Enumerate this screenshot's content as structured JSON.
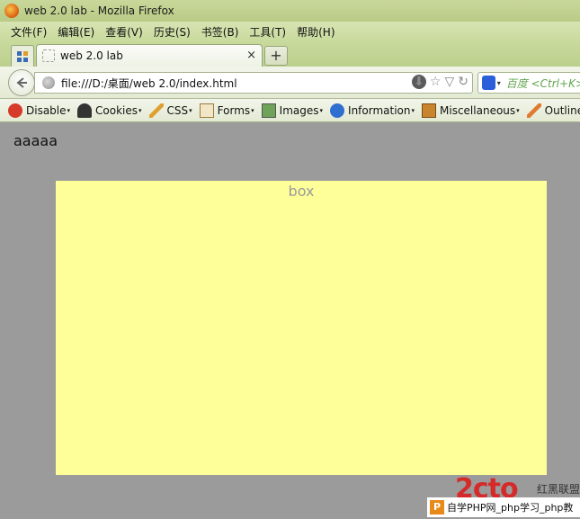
{
  "window": {
    "title": "web 2.0 lab - Mozilla Firefox"
  },
  "menubar": {
    "items": [
      "文件(F)",
      "编辑(E)",
      "查看(V)",
      "历史(S)",
      "书签(B)",
      "工具(T)",
      "帮助(H)"
    ]
  },
  "tabs": {
    "active": {
      "label": "web 2.0 lab",
      "close": "×"
    },
    "new_tab": "+"
  },
  "navbar": {
    "url": "file:///D:/桌面/web 2.0/index.html",
    "search_placeholder": "百度 <Ctrl+K>"
  },
  "devbar": {
    "items": [
      {
        "label": "Disable",
        "icon": "disable-icon"
      },
      {
        "label": "Cookies",
        "icon": "cookie-icon"
      },
      {
        "label": "CSS",
        "icon": "css-pencil-icon"
      },
      {
        "label": "Forms",
        "icon": "forms-icon"
      },
      {
        "label": "Images",
        "icon": "images-icon"
      },
      {
        "label": "Information",
        "icon": "information-icon"
      },
      {
        "label": "Miscellaneous",
        "icon": "miscellaneous-icon"
      },
      {
        "label": "Outline",
        "icon": "outline-icon"
      }
    ]
  },
  "page": {
    "text": "aaaaa",
    "box_label": "box"
  },
  "watermark": {
    "logo": "2cto",
    "sub": "红黑联盟",
    "icon": "P",
    "text": "自学PHP网_php学习_php教"
  },
  "colors": {
    "page_bg": "#9b9b9b",
    "box_bg": "#ffff99"
  }
}
